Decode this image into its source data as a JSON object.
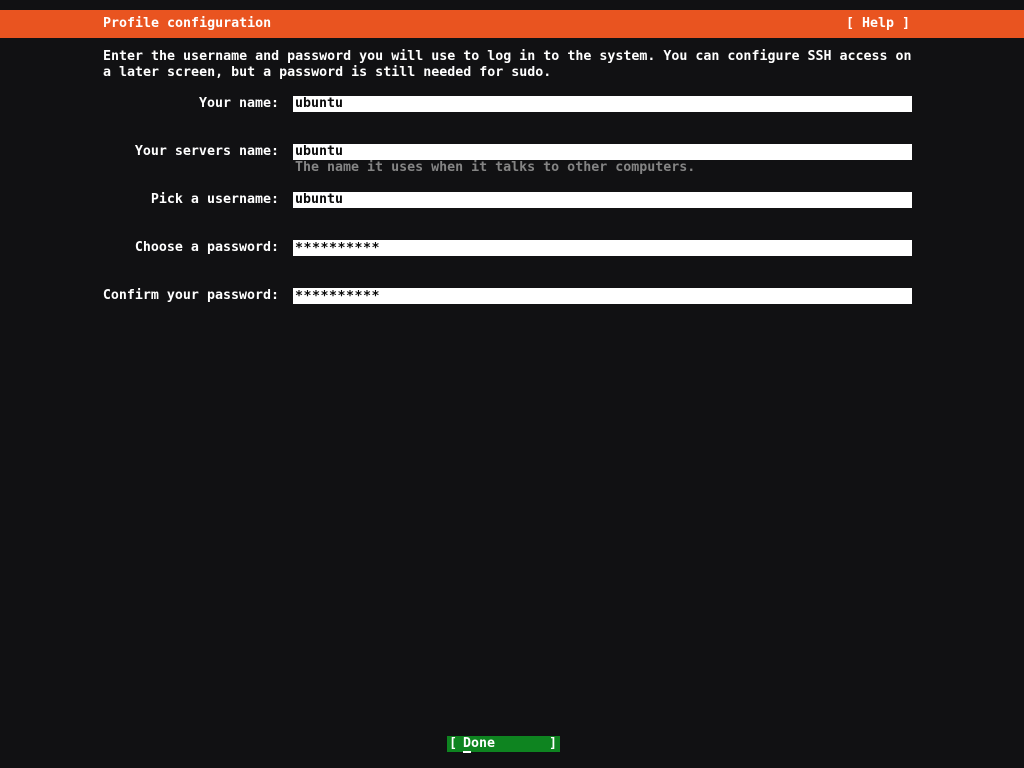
{
  "header": {
    "title": "Profile configuration",
    "help_label": "[ Help ]"
  },
  "intro": {
    "line1": "Enter the username and password you will use to log in to the system. You can configure SSH access on",
    "line2": "a later screen, but a password is still needed for sudo."
  },
  "form": {
    "fields": [
      {
        "label": "Your name:",
        "value": "ubuntu",
        "type": "text"
      },
      {
        "label": "Your servers name:",
        "value": "ubuntu",
        "type": "text",
        "hint": "The name it uses when it talks to other computers."
      },
      {
        "label": "Pick a username:",
        "value": "ubuntu",
        "type": "text"
      },
      {
        "label": "Choose a password:",
        "value": "**********",
        "type": "password"
      },
      {
        "label": "Confirm your password:",
        "value": "**********",
        "type": "password"
      }
    ]
  },
  "footer": {
    "bracket_left": "[",
    "done_first": "D",
    "done_rest": "one",
    "bracket_right": "]"
  },
  "colors": {
    "background": "#111113",
    "accent_orange": "#E95420",
    "done_green": "#0E8420",
    "hint_gray": "#848484",
    "text_white": "#FFFFFF"
  }
}
